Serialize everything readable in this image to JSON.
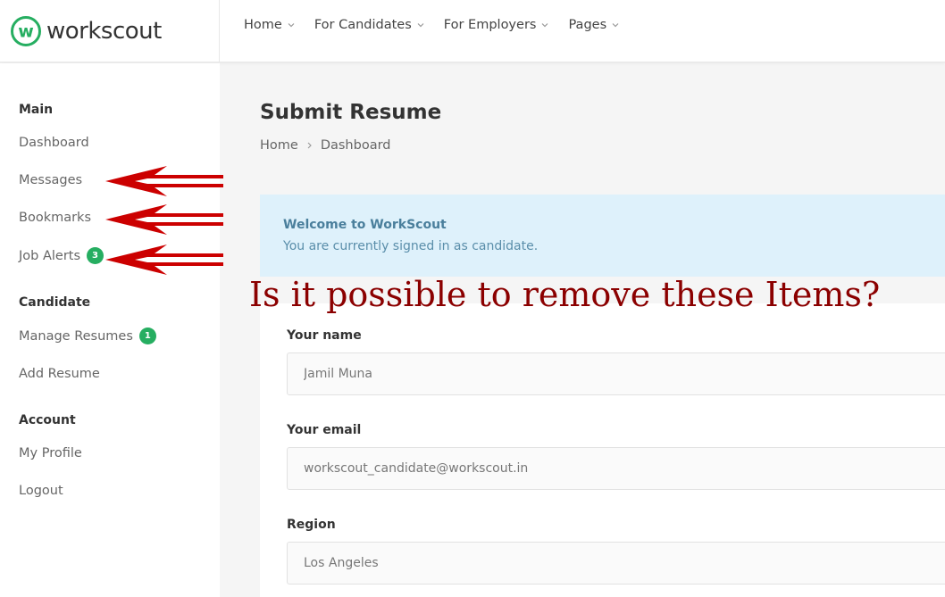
{
  "brand": {
    "name": "workscout",
    "logo_letter": "w",
    "accent": "#26ae61"
  },
  "nav": {
    "items": [
      {
        "label": "Home"
      },
      {
        "label": "For Candidates"
      },
      {
        "label": "For Employers"
      },
      {
        "label": "Pages"
      }
    ]
  },
  "sidebar": {
    "main_heading": "Main",
    "dashboard": "Dashboard",
    "messages": "Messages",
    "bookmarks": "Bookmarks",
    "job_alerts": "Job Alerts",
    "job_alerts_count": "3",
    "candidate_heading": "Candidate",
    "manage_resumes": "Manage Resumes",
    "manage_resumes_count": "1",
    "add_resume": "Add Resume",
    "account_heading": "Account",
    "my_profile": "My Profile",
    "logout": "Logout"
  },
  "main": {
    "title": "Submit Resume",
    "breadcrumb": [
      "Home",
      "Dashboard"
    ],
    "notice": {
      "title": "Welcome to WorkScout",
      "text": "You are currently signed in as candidate."
    },
    "form": {
      "name_label": "Your name",
      "name_value": "Jamil Muna",
      "email_label": "Your email",
      "email_value": "workscout_candidate@workscout.in",
      "region_label": "Region",
      "region_value": "Los Angeles"
    }
  },
  "annotation": {
    "text": "Is it possible to remove these Items?",
    "color": "#8b0000",
    "arrow_color": "#cc0000"
  }
}
